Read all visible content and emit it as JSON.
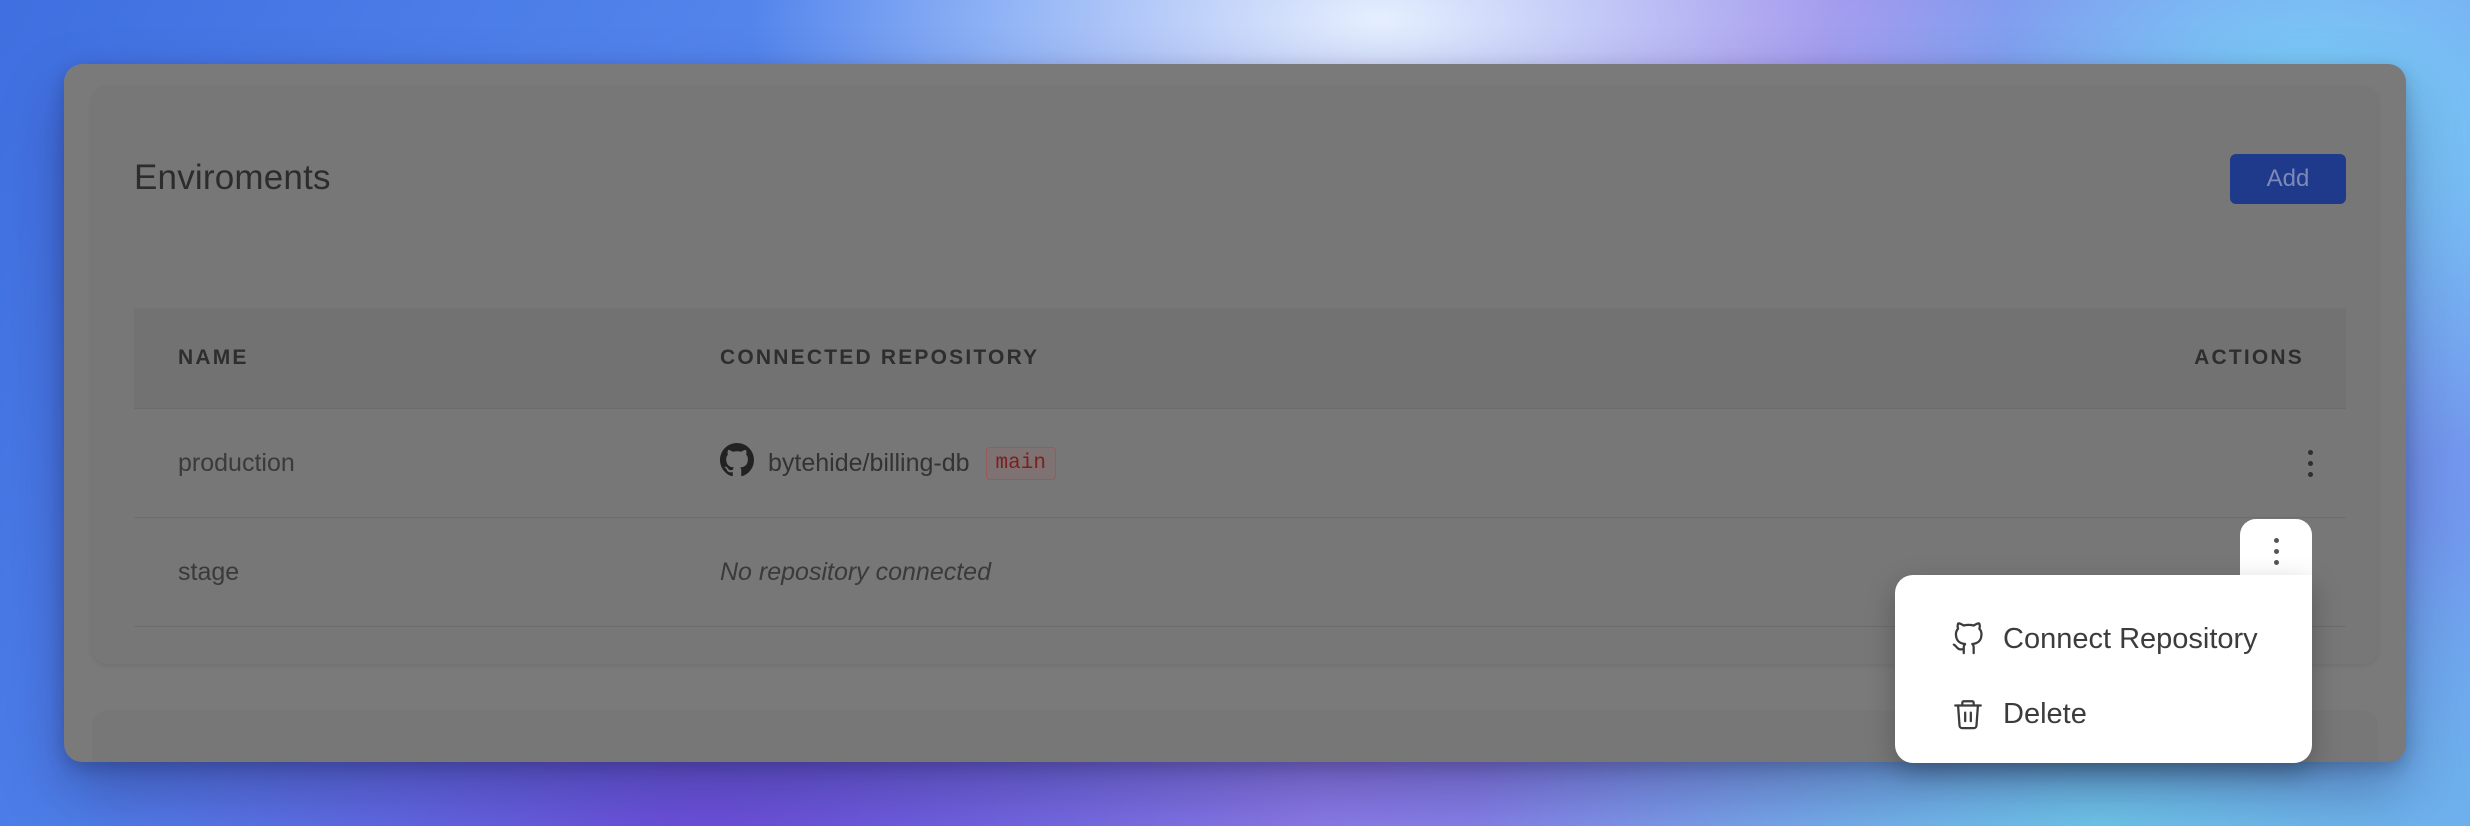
{
  "page": {
    "title": "Enviroments",
    "add_button_label": "Add"
  },
  "table": {
    "headers": {
      "name": "NAME",
      "repository": "CONNECTED REPOSITORY",
      "actions": "ACTIONS"
    },
    "rows": [
      {
        "name": "production",
        "repository": "bytehide/billing-db",
        "branch": "main",
        "repository_icon": "github-icon"
      },
      {
        "name": "stage",
        "repository_placeholder": "No repository connected"
      }
    ]
  },
  "actions_menu": {
    "items": [
      {
        "label": "Connect Repository",
        "icon": "github-outline-icon"
      },
      {
        "label": "Delete",
        "icon": "trash-icon"
      }
    ]
  },
  "colors": {
    "primary_button": "#1f3a8a",
    "overlay": "#7a7a7a",
    "menu_background": "#ffffff"
  }
}
